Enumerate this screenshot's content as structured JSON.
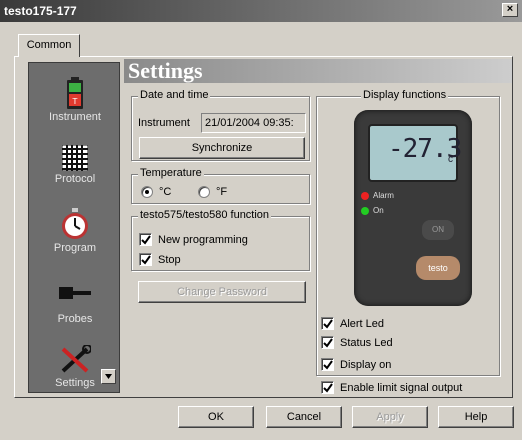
{
  "window": {
    "title": "testo175-177",
    "close_label": "×"
  },
  "tabs": [
    {
      "label": "Common"
    }
  ],
  "sidebar": {
    "items": [
      {
        "label": "Instrument",
        "icon": "battery-icon"
      },
      {
        "label": "Protocol",
        "icon": "table-icon"
      },
      {
        "label": "Program",
        "icon": "stopwatch-icon"
      },
      {
        "label": "Probes",
        "icon": "probe-icon"
      },
      {
        "label": "Settings",
        "icon": "tools-icon"
      }
    ]
  },
  "header": {
    "title": "Settings"
  },
  "date_time": {
    "legend": "Date and time",
    "instrument_label": "Instrument",
    "instrument_value": "21/01/2004 09:35:",
    "sync_button": "Synchronize"
  },
  "temperature": {
    "legend": "Temperature",
    "options": [
      {
        "label": "°C",
        "selected": true
      },
      {
        "label": "°F",
        "selected": false
      }
    ]
  },
  "function_group": {
    "legend": "testo575/testo580 function",
    "options": [
      {
        "label": "New programming",
        "checked": true
      },
      {
        "label": "Stop",
        "checked": true
      }
    ]
  },
  "change_password_button": "Change Password",
  "display_functions": {
    "legend": "Display functions",
    "device": {
      "reading": "-27.3",
      "unit": "c",
      "alarm_label": "Alarm",
      "on_label": "On",
      "on_button": "ON",
      "brand": "testo"
    },
    "options": [
      {
        "label": "Alert Led",
        "checked": true
      },
      {
        "label": "Status Led",
        "checked": true
      },
      {
        "label": "Display on",
        "checked": true
      }
    ]
  },
  "enable_limit": {
    "label": "Enable limit signal output",
    "checked": true
  },
  "footer": {
    "ok": "OK",
    "cancel": "Cancel",
    "apply": "Apply",
    "help": "Help"
  }
}
